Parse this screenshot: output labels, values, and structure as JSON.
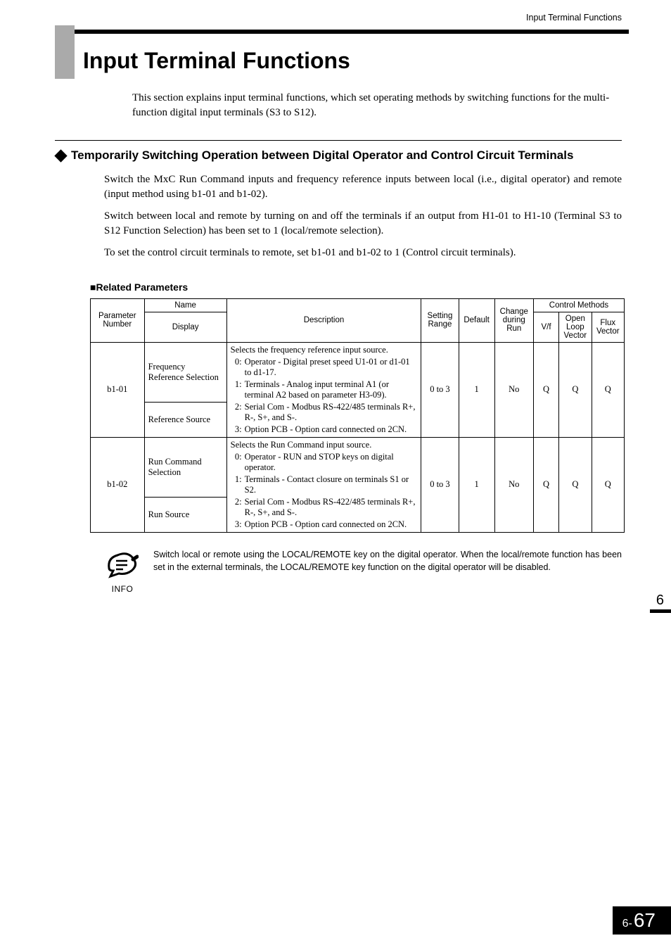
{
  "header": {
    "running_title": "Input Terminal Functions"
  },
  "title": "Input Terminal Functions",
  "intro": "This section explains input terminal functions, which set operating methods by switching functions for the multi-function digital input terminals (S3 to S12).",
  "section": {
    "heading": "Temporarily Switching Operation between Digital Operator and Control Circuit Terminals",
    "paragraphs": [
      "Switch the MxC Run Command inputs and frequency reference inputs between local (i.e., digital operator) and remote (input method using b1-01 and b1-02).",
      "Switch between local and remote by turning on and off the terminals if an output from H1-01 to H1-10 (Terminal S3 to S12 Function Selection) has been set to 1 (local/remote selection).",
      "To set the control circuit terminals to remote, set b1-01 and b1-02 to 1 (Control circuit terminals)."
    ]
  },
  "table": {
    "subheading": "Related Parameters",
    "head": {
      "param_no": "Parameter Number",
      "name": "Name",
      "display": "Display",
      "description": "Description",
      "setting_range": "Setting Range",
      "default": "Default",
      "change": "Change during Run",
      "control_methods": "Control Methods",
      "vf": "V/f",
      "olv": "Open Loop Vector",
      "flux": "Flux Vector"
    },
    "rows": [
      {
        "param": "b1-01",
        "name": "Frequency Reference Selection",
        "display": "Reference Source",
        "desc_lead": "Selects the frequency reference input source.",
        "desc_items": [
          {
            "n": "0:",
            "t": "Operator - Digital preset speed U1-01 or d1-01 to d1-17."
          },
          {
            "n": "1:",
            "t": "Terminals - Analog input terminal A1 (or terminal A2 based on parameter H3-09)."
          },
          {
            "n": "2:",
            "t": "Serial Com - Modbus RS-422/485 terminals R+, R-, S+, and S-."
          },
          {
            "n": "3:",
            "t": "Option PCB - Option card connected on 2CN."
          }
        ],
        "range": "0 to 3",
        "default": "1",
        "change": "No",
        "vf": "Q",
        "olv": "Q",
        "flux": "Q"
      },
      {
        "param": "b1-02",
        "name": "Run Command Selection",
        "display": "Run Source",
        "desc_lead": "Selects the Run Command input source.",
        "desc_items": [
          {
            "n": "0:",
            "t": "Operator - RUN and STOP keys on digital operator."
          },
          {
            "n": "1:",
            "t": "Terminals - Contact closure on terminals S1 or S2."
          },
          {
            "n": "2:",
            "t": "Serial Com - Modbus RS-422/485 terminals R+, R-, S+, and S-."
          },
          {
            "n": "3:",
            "t": "Option PCB - Option card connected on 2CN."
          }
        ],
        "range": "0 to 3",
        "default": "1",
        "change": "No",
        "vf": "Q",
        "olv": "Q",
        "flux": "Q"
      }
    ]
  },
  "info": {
    "label": "INFO",
    "text": "Switch local or remote using the LOCAL/REMOTE key on the digital operator. When the local/remote function has been set in the external terminals, the LOCAL/REMOTE key function on the digital operator will be disabled."
  },
  "side_tab": "6",
  "footer": {
    "chapter": "6-",
    "page": "67"
  }
}
